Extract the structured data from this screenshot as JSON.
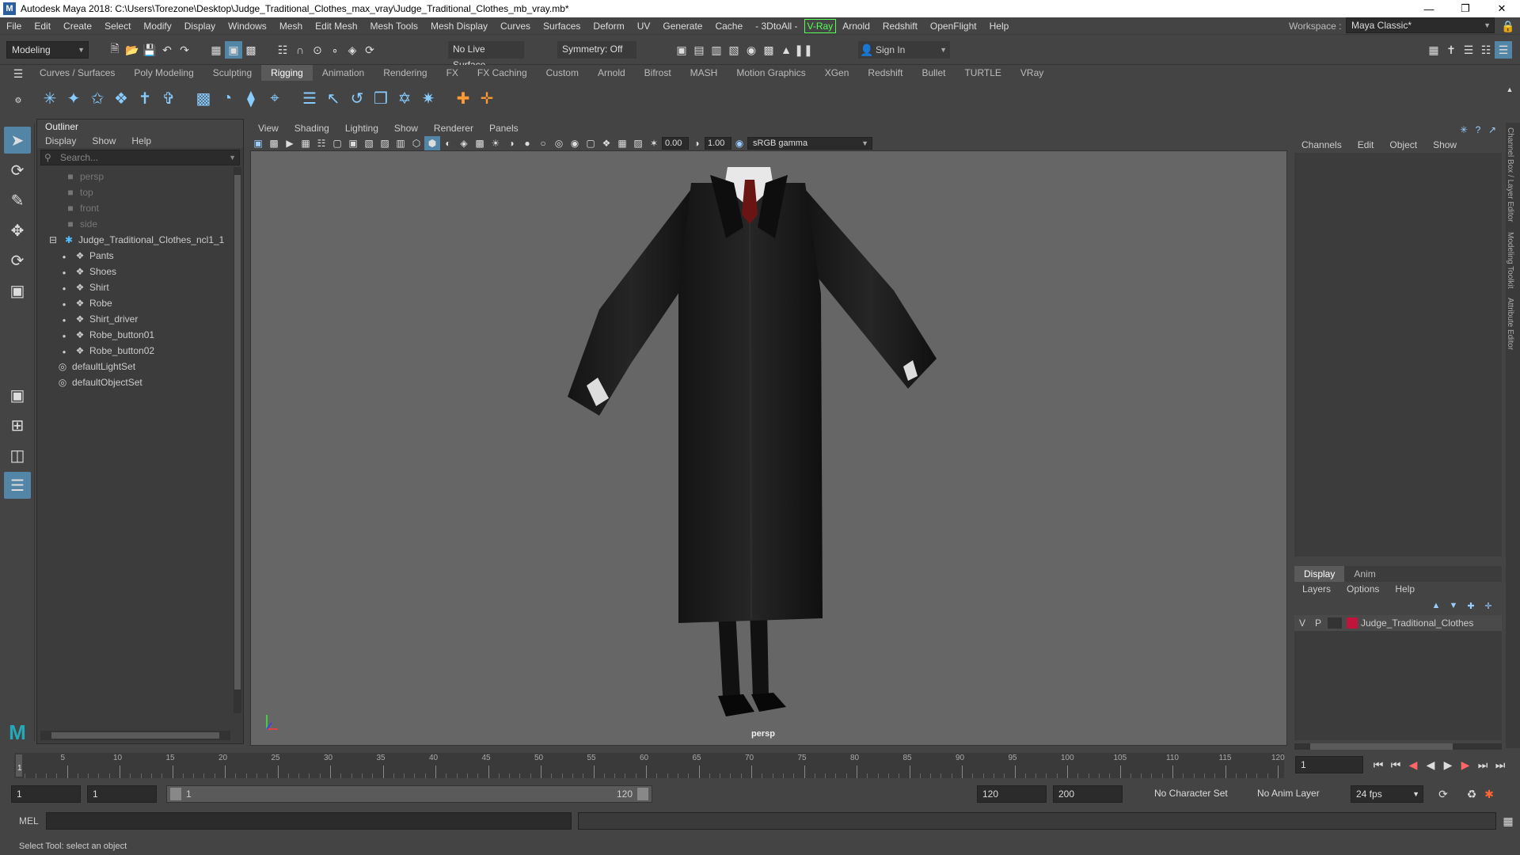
{
  "titlebar": {
    "title": "Autodesk Maya 2018: C:\\Users\\Torezone\\Desktop\\Judge_Traditional_Clothes_max_vray\\Judge_Traditional_Clothes_mb_vray.mb*"
  },
  "menubar": {
    "items": [
      "File",
      "Edit",
      "Create",
      "Select",
      "Modify",
      "Display",
      "Windows",
      "Mesh",
      "Edit Mesh",
      "Mesh Tools",
      "Mesh Display",
      "Curves",
      "Surfaces",
      "Deform",
      "UV",
      "Generate",
      "Cache",
      "- 3DtoAll -",
      "V-Ray",
      "Arnold",
      "Redshift",
      "OpenFlight",
      "Help"
    ],
    "workspace_label": "Workspace :",
    "workspace_value": "Maya Classic*"
  },
  "statusline": {
    "mode": "Modeling",
    "live_surface": "No Live Surface",
    "symmetry": "Symmetry: Off",
    "sign_in": "Sign In"
  },
  "shelf": {
    "tabs": [
      "Curves / Surfaces",
      "Poly Modeling",
      "Sculpting",
      "Rigging",
      "Animation",
      "Rendering",
      "FX",
      "FX Caching",
      "Custom",
      "Arnold",
      "Bifrost",
      "MASH",
      "Motion Graphics",
      "XGen",
      "Redshift",
      "Bullet",
      "TURTLE",
      "VRay"
    ],
    "active_tab": "Rigging"
  },
  "outliner": {
    "title": "Outliner",
    "menu": [
      "Display",
      "Show",
      "Help"
    ],
    "search_placeholder": "Search...",
    "cameras": [
      "persp",
      "top",
      "front",
      "side"
    ],
    "root": "Judge_Traditional_Clothes_ncl1_1",
    "children": [
      "Pants",
      "Shoes",
      "Shirt",
      "Robe",
      "Shirt_driver",
      "Robe_button01",
      "Robe_button02"
    ],
    "sets": [
      "defaultLightSet",
      "defaultObjectSet"
    ]
  },
  "viewport": {
    "menu": [
      "View",
      "Shading",
      "Lighting",
      "Show",
      "Renderer",
      "Panels"
    ],
    "exposure": "0.00",
    "gamma": "1.00",
    "color_space": "sRGB gamma",
    "camera_label": "persp"
  },
  "channelbox": {
    "menu": [
      "Channels",
      "Edit",
      "Object",
      "Show"
    ],
    "side_tabs": [
      "Channel Box / Layer Editor",
      "Modeling Toolkit",
      "Attribute Editor"
    ],
    "layer_tabs": [
      "Display",
      "Anim"
    ],
    "layer_menu": [
      "Layers",
      "Options",
      "Help"
    ],
    "layer": {
      "v": "V",
      "p": "P",
      "name": "Judge_Traditional_Clothes",
      "color": "#c0143c"
    }
  },
  "timeline": {
    "ticks": [
      "5",
      "10",
      "15",
      "20",
      "25",
      "30",
      "35",
      "40",
      "45",
      "50",
      "55",
      "60",
      "65",
      "70",
      "75",
      "80",
      "85",
      "90",
      "95",
      "100",
      "105",
      "110",
      "115",
      "120"
    ],
    "current_frame": "1",
    "current_frame_field": "1"
  },
  "range": {
    "start": "1",
    "start_inner": "1",
    "slider_start": "1",
    "slider_end": "120",
    "end_inner": "120",
    "end": "200",
    "character_set": "No Character Set",
    "anim_layer": "No Anim Layer",
    "fps": "24 fps"
  },
  "cmdline": {
    "label": "MEL"
  },
  "helpline": {
    "text": "Select Tool: select an object"
  }
}
